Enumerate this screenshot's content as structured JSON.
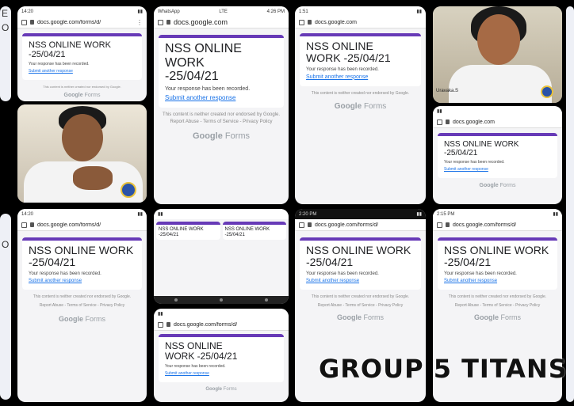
{
  "form": {
    "url": "docs.google.com/forms/d/",
    "url_short": "docs.google.com",
    "title_line1": "NSS ONLINE WORK",
    "title_line2": "-25/04/21",
    "title_short1": "NSS ONLINE",
    "title_short2": "WORK -25/04/21",
    "response_msg": "Your response has been recorded.",
    "submit_link": "Submit another response",
    "disclaimer": "This content is neither created nor endorsed by Google.",
    "links": "Report Abuse - Terms of Service - Privacy Policy",
    "brand_google": "Google",
    "brand_forms": "Forms"
  },
  "status": {
    "whatsapp": "WhatsApp",
    "network": "LTE",
    "time1": "4:26 PM",
    "time2": "1:51",
    "time3": "14:20",
    "time4": "2:20 PM",
    "time5": "2:15 PM"
  },
  "photos": {
    "caption_right": "Uravaka.S"
  },
  "edge_text": {
    "left_top": "E",
    "left_top2": "O",
    "left_mid": "O"
  },
  "overlay": {
    "group_label": "GROUP 5 TITANS"
  },
  "colors": {
    "form_accent": "#673ab7",
    "link": "#1a73e8",
    "background": "#000000"
  }
}
